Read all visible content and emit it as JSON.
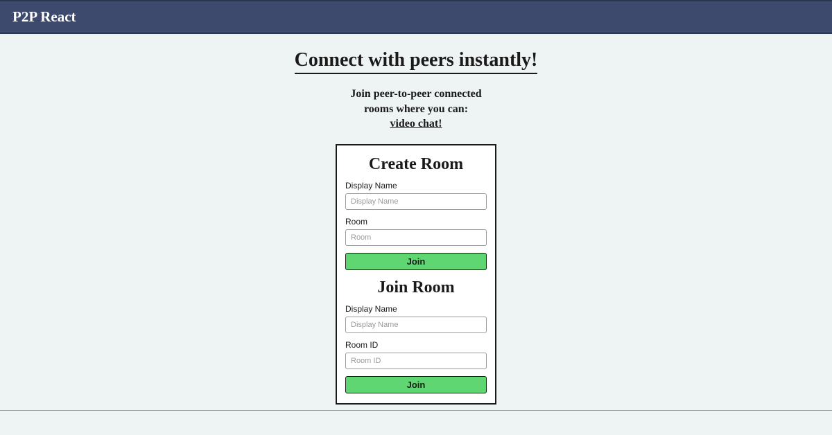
{
  "header": {
    "app_title": "P2P React"
  },
  "hero": {
    "title": "Connect with peers instantly!",
    "sub_line1": "Join peer-to-peer connected",
    "sub_line2": "rooms where you can:",
    "sub_line3": "video chat!"
  },
  "create_room": {
    "title": "Create Room",
    "display_name_label": "Display Name",
    "display_name_placeholder": "Display Name",
    "room_label": "Room",
    "room_placeholder": "Room",
    "join_button": "Join"
  },
  "join_room": {
    "title": "Join Room",
    "display_name_label": "Display Name",
    "display_name_placeholder": "Display Name",
    "room_id_label": "Room ID",
    "room_id_placeholder": "Room ID",
    "join_button": "Join"
  }
}
